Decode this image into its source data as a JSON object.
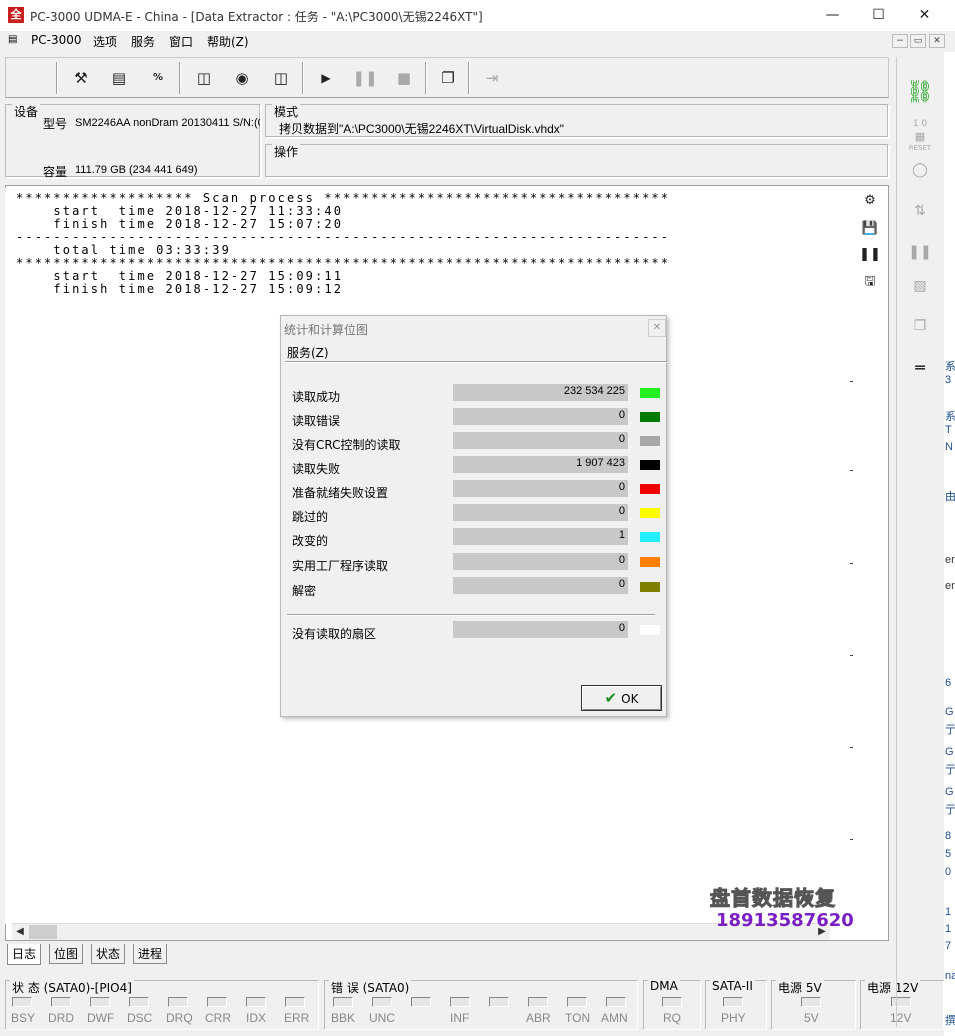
{
  "window": {
    "title": "PC-3000 UDMA-E - China - [Data Extractor : 任务 - \"A:\\PC3000\\无锡2246XT\"]",
    "icon_text": "全",
    "minimize": "—",
    "maximize": "☐",
    "close": "✕"
  },
  "menu": {
    "items": [
      "PC-3000",
      "选项",
      "服务",
      "窗口",
      "帮助(Z)"
    ],
    "mdi_buttons": [
      "−",
      "▭",
      "✕"
    ]
  },
  "toolbar": {
    "icons": [
      "tools-icon",
      "report-icon",
      "percent-icon",
      "device-icon",
      "binoculars-icon",
      "folder-open-icon",
      "play-icon",
      "pause-icon",
      "stop-icon",
      "windows-icon",
      "exit-icon"
    ]
  },
  "device": {
    "group_title": "设备",
    "model_label": "型号",
    "model_value": "SM2246AA nonDram 20130411 S/N:(0",
    "capacity_label": "容量",
    "capacity_value": "111.79 GB (234 441 649)"
  },
  "mode": {
    "group_title": "模式",
    "value": "拷贝数据到\"A:\\PC3000\\无锡2246XT\\VirtualDisk.vhdx\""
  },
  "operation": {
    "group_title": "操作"
  },
  "log": {
    "lines": [
      "******************* Scan process *************************************",
      "    start  time 2018-12-27 11:33:40",
      "    finish time 2018-12-27 15:07:20",
      "----------------------------------------------------------------------",
      "    total time 03:33:39",
      "**********************************************************************",
      "    start  time 2018-12-27 15:09:11",
      "    finish time 2018-12-27 15:09:12"
    ]
  },
  "bottom_tabs": [
    "日志",
    "位图",
    "状态",
    "进程"
  ],
  "dialog": {
    "title": "统计和计算位图",
    "menu": "服务(Z)",
    "close": "✕",
    "rows": [
      {
        "label": "读取成功",
        "value": "232 534 225",
        "color": "#22ee22"
      },
      {
        "label": "读取错误",
        "value": "0",
        "color": "#007a00"
      },
      {
        "label": "没有CRC控制的读取",
        "value": "0",
        "color": "#a8a8a8"
      },
      {
        "label": "读取失败",
        "value": "1 907 423",
        "color": "#000000"
      },
      {
        "label": "准备就绪失败设置",
        "value": "0",
        "color": "#ee0000"
      },
      {
        "label": "跳过的",
        "value": "0",
        "color": "#ffff00"
      },
      {
        "label": "改变的",
        "value": "1",
        "color": "#22eeff"
      },
      {
        "label": "实用工厂程序读取",
        "value": "0",
        "color": "#ff8000"
      },
      {
        "label": "解密",
        "value": "0",
        "color": "#808000"
      }
    ],
    "unread": {
      "label": "没有读取的扇区",
      "value": "0",
      "color": "#ffffff"
    },
    "ok_label": "OK"
  },
  "status": {
    "group1_title": "状 态 (SATA0)-[PIO4]",
    "group1_leds": [
      "BSY",
      "DRD",
      "DWF",
      "DSC",
      "DRQ",
      "CRR",
      "IDX",
      "ERR"
    ],
    "group2_title": "错 误 (SATA0)",
    "group2_leds": [
      "BBK",
      "UNC",
      "",
      "INF",
      "",
      "ABR",
      "TON",
      "AMN"
    ],
    "dma_title": "DMA",
    "dma_led": "RQ",
    "sata_title": "SATA-II",
    "sata_led": "PHY",
    "p5_title": "电源 5V",
    "p5_led": "5V",
    "p12_title": "电源 12V",
    "p12_led": "12V"
  },
  "watermark": {
    "line1": "盘首数据恢复",
    "line2": "18913587620"
  },
  "right_panel": {
    "reset_label": "RESET",
    "io_label": "1 0"
  },
  "edge_chars": [
    "系",
    "3",
    "系",
    "T",
    "N",
    "由",
    "er",
    "er",
    "6",
    "G",
    "亍",
    "G",
    "亍",
    "G",
    "亍",
    "8",
    "5",
    "0",
    "1",
    "1",
    "7",
    "na",
    "撰"
  ]
}
